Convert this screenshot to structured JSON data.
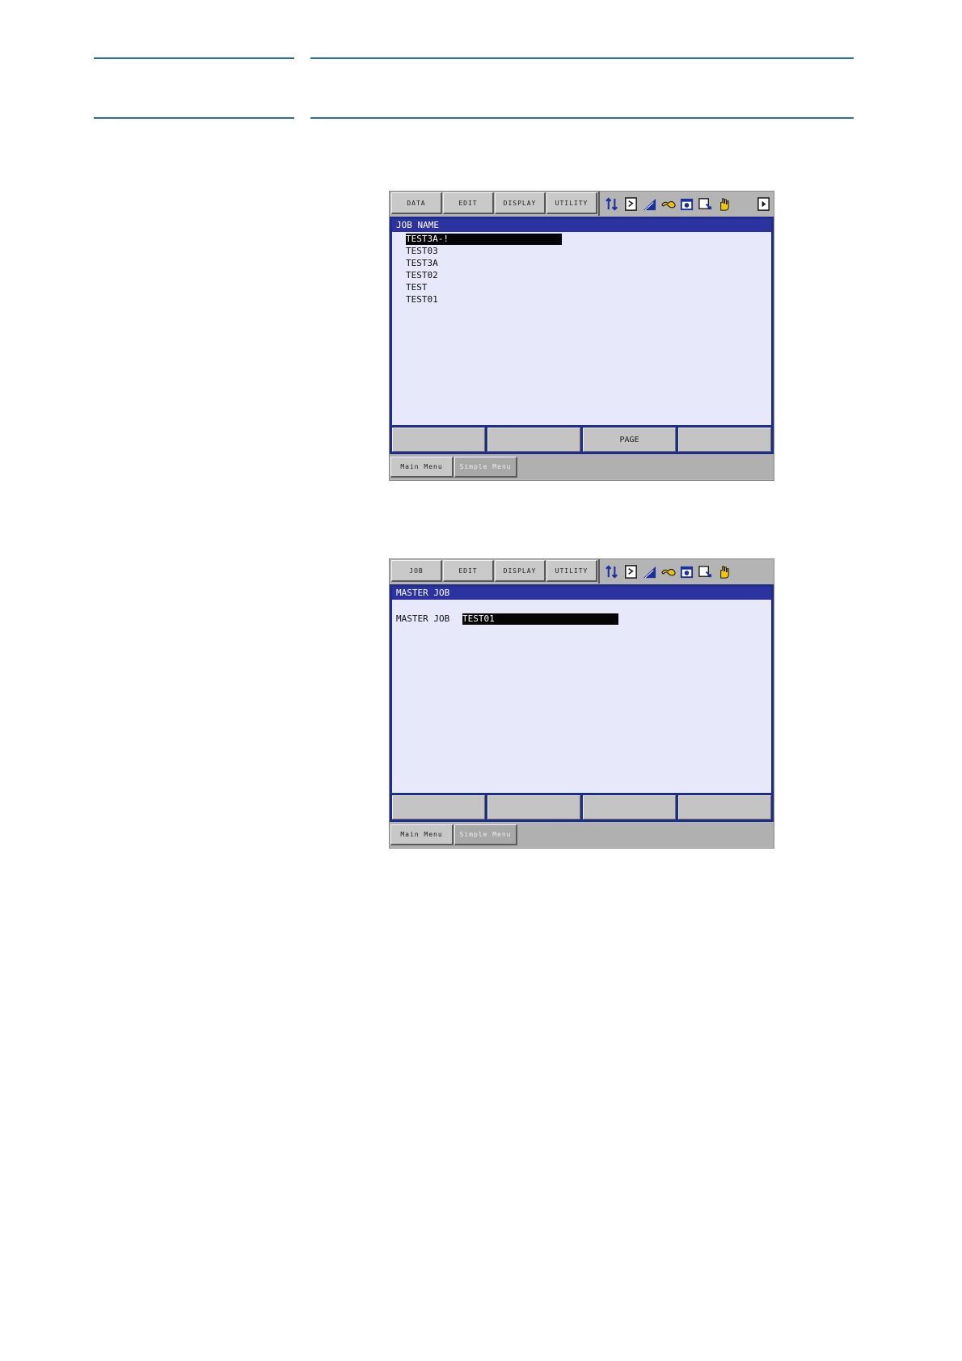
{
  "screen1": {
    "menu": [
      "DATA",
      "EDIT",
      "DISPLAY",
      "UTILITY"
    ],
    "status_icons": [
      "sort-arrows-icon",
      "document-icon",
      "signal-icon",
      "robot-icon",
      "calendar-icon",
      "edit-cursor-icon",
      "hand-icon",
      "page-arrow-icon"
    ],
    "title": "JOB NAME",
    "jobs": [
      "TEST3A-!",
      "TEST03",
      "TEST3A",
      "TEST02",
      "TEST",
      "TEST01"
    ],
    "function_keys": [
      "",
      "",
      "PAGE",
      ""
    ],
    "bottom": {
      "main_menu": "Main Menu",
      "simple_menu": "Simple Menu"
    }
  },
  "screen2": {
    "menu": [
      "JOB",
      "EDIT",
      "DISPLAY",
      "UTILITY"
    ],
    "status_icons": [
      "sort-arrows-icon",
      "document-icon",
      "signal-icon",
      "robot-icon",
      "calendar-icon",
      "edit-cursor-icon",
      "hand-icon"
    ],
    "title": "MASTER JOB",
    "field_label": "MASTER JOB",
    "field_value": "TEST01",
    "function_keys": [
      "",
      "",
      "",
      ""
    ],
    "bottom": {
      "main_menu": "Main Menu",
      "simple_menu": "Simple Menu"
    }
  }
}
